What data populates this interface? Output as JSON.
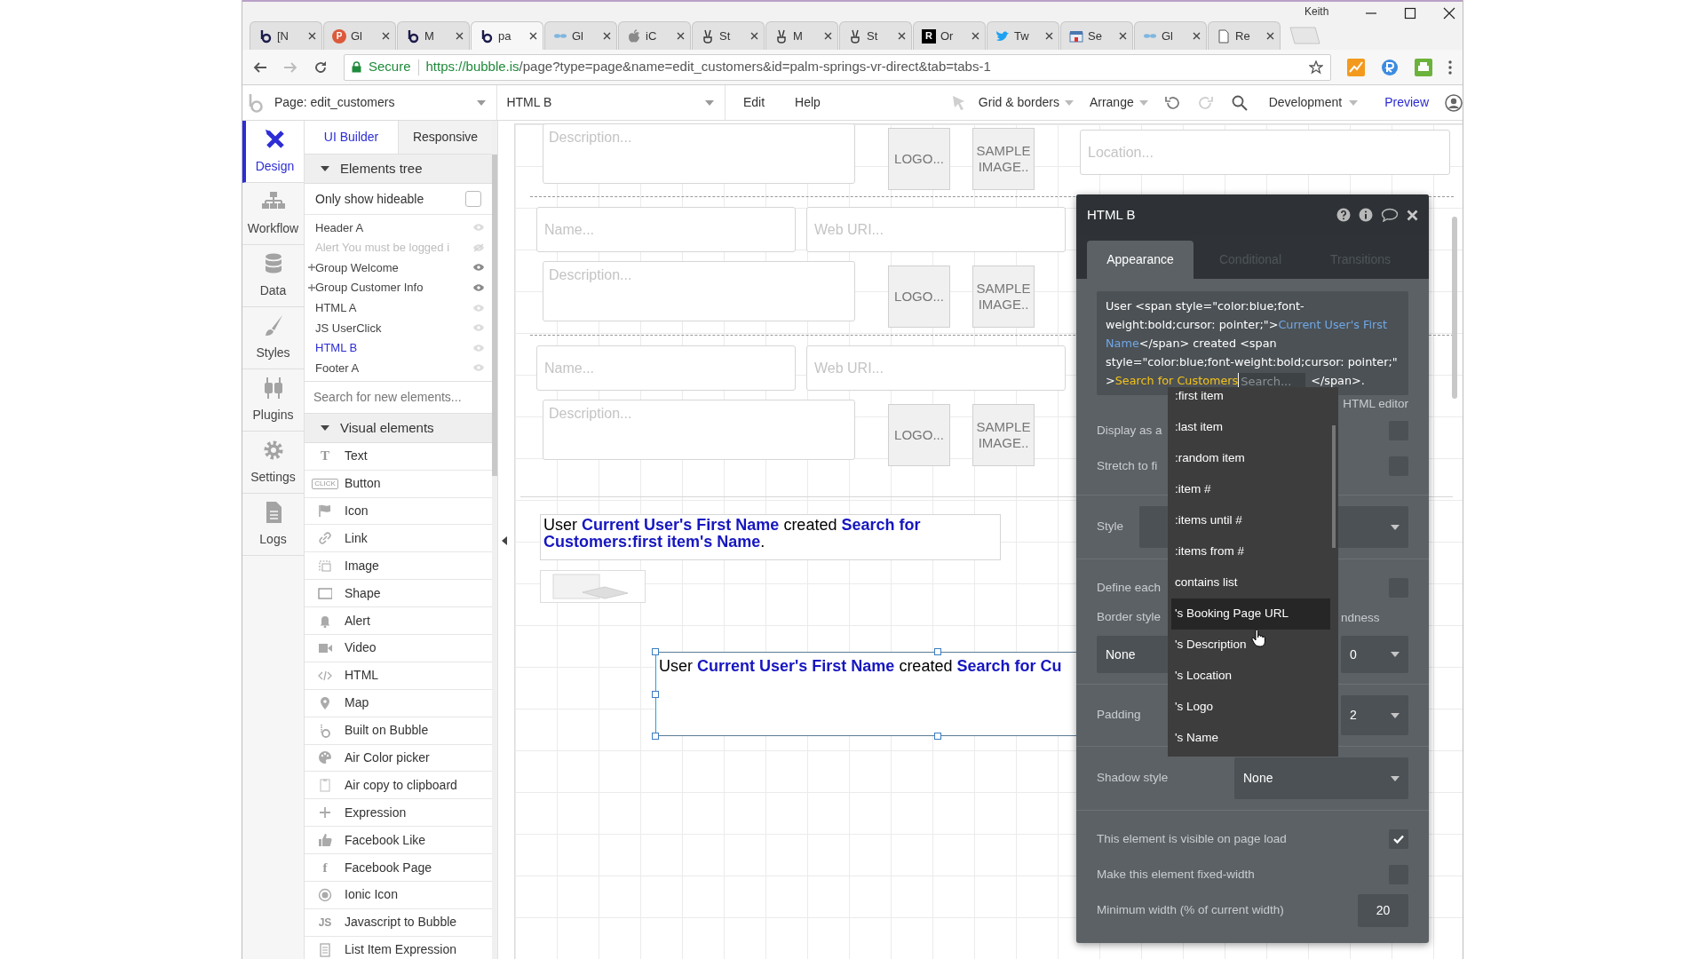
{
  "browser": {
    "tabs": [
      {
        "label": "[N",
        "kind": "bubble",
        "selected": false
      },
      {
        "label": "Gl",
        "kind": "circle-letter",
        "icon_text": "P",
        "selected": false
      },
      {
        "label": "M",
        "kind": "bubble",
        "selected": false
      },
      {
        "label": "pa",
        "kind": "bubble",
        "selected": true
      },
      {
        "label": "Gl",
        "kind": "glasses",
        "selected": false
      },
      {
        "label": "iC",
        "kind": "apple",
        "selected": false
      },
      {
        "label": "St",
        "kind": "hand",
        "selected": false
      },
      {
        "label": "M",
        "kind": "hand",
        "selected": false
      },
      {
        "label": "St",
        "kind": "hand",
        "selected": false
      },
      {
        "label": "Or",
        "kind": "square-letter",
        "icon_text": "R",
        "selected": false
      },
      {
        "label": "Tw",
        "kind": "bird",
        "selected": false
      },
      {
        "label": "Se",
        "kind": "store",
        "selected": false
      },
      {
        "label": "Gl",
        "kind": "glasses",
        "selected": false
      },
      {
        "label": "Re",
        "kind": "page",
        "selected": false
      }
    ],
    "user": "Keith",
    "secure_label": "Secure",
    "url_host": "https://bubble.is",
    "url_path": "/page?type=page&name=edit_customers&id=palm-springs-vr-direct&tab=tabs-1"
  },
  "toolbar": {
    "page_select": "Page: edit_customers",
    "element_select": "HTML B",
    "menus": [
      "Edit",
      "Help"
    ],
    "grid": "Grid & borders",
    "arrange": "Arrange",
    "mode": "Development",
    "preview": "Preview"
  },
  "nav": [
    {
      "label": "Design",
      "kind": "design",
      "selected": true
    },
    {
      "label": "Workflow",
      "kind": "workflow",
      "selected": false
    },
    {
      "label": "Data",
      "kind": "data",
      "selected": false
    },
    {
      "label": "Styles",
      "kind": "styles",
      "selected": false
    },
    {
      "label": "Plugins",
      "kind": "plugins",
      "selected": false
    },
    {
      "label": "Settings",
      "kind": "settings",
      "selected": false
    },
    {
      "label": "Logs",
      "kind": "logs",
      "selected": false
    }
  ],
  "builder_tabs": [
    {
      "label": "UI Builder",
      "selected": true
    },
    {
      "label": "Responsive",
      "selected": false
    }
  ],
  "elements_tree": {
    "title": "Elements tree",
    "hideable_label": "Only show hideable",
    "hideable_checked": false,
    "items": [
      {
        "label": "Header A",
        "expandable": false,
        "selected": false,
        "visible": true
      },
      {
        "label": "Alert You must be logged i",
        "expandable": false,
        "selected": false,
        "visible": false
      },
      {
        "label": "Group Welcome",
        "expandable": true,
        "selected": false,
        "visible": true
      },
      {
        "label": "Group Customer Info",
        "expandable": true,
        "selected": false,
        "visible": true
      },
      {
        "label": "HTML A",
        "expandable": false,
        "selected": false,
        "visible": true
      },
      {
        "label": "JS UserClick",
        "expandable": false,
        "selected": false,
        "visible": true
      },
      {
        "label": "HTML B",
        "expandable": false,
        "selected": true,
        "visible": true
      },
      {
        "label": "Footer A",
        "expandable": false,
        "selected": false,
        "visible": true
      }
    ],
    "search_placeholder": "Search for new elements..."
  },
  "visual_elements": {
    "title": "Visual elements",
    "items": [
      {
        "label": "Text",
        "kind": "letter",
        "icon_text": "T"
      },
      {
        "label": "Button",
        "kind": "badge",
        "icon_text": "CLICK"
      },
      {
        "label": "Icon",
        "kind": "flag"
      },
      {
        "label": "Link",
        "kind": "link"
      },
      {
        "label": "Image",
        "kind": "image"
      },
      {
        "label": "Shape",
        "kind": "shape"
      },
      {
        "label": "Alert",
        "kind": "bell"
      },
      {
        "label": "Video",
        "kind": "video"
      },
      {
        "label": "HTML",
        "kind": "code"
      },
      {
        "label": "Map",
        "kind": "pin"
      },
      {
        "label": "Built on Bubble",
        "kind": "bubble"
      },
      {
        "label": "Air Color picker",
        "kind": "palette"
      },
      {
        "label": "Air copy to clipboard",
        "kind": "clipboard"
      },
      {
        "label": "Expression",
        "kind": "plus"
      },
      {
        "label": "Facebook Like",
        "kind": "thumb"
      },
      {
        "label": "Facebook Page",
        "kind": "letter",
        "icon_text": "f"
      },
      {
        "label": "Ionic Icon",
        "kind": "ring"
      },
      {
        "label": "Javascript to Bubble",
        "kind": "letter",
        "icon_text": "JS"
      },
      {
        "label": "List Item Expression",
        "kind": "list"
      }
    ]
  },
  "canvas": {
    "location_placeholder": "Location...",
    "cells": [
      {
        "kind": "partial",
        "description_placeholder": "Description...",
        "logo": "LOGO...",
        "sample_image": "SAMPLE IMAGE.."
      },
      {
        "kind": "full",
        "name_placeholder": "Name...",
        "url_placeholder": "Web URI...",
        "description_placeholder": "Description...",
        "logo": "LOGO...",
        "sample_image": "SAMPLE IMAGE.."
      },
      {
        "kind": "full",
        "name_placeholder": "Name...",
        "url_placeholder": "Web URI...",
        "description_placeholder": "Description...",
        "logo": "LOGO...",
        "sample_image": "SAMPLE IMAGE.."
      }
    ],
    "text_element": "User **Current User's First Name** created **Search for Customers:first item's Name**.",
    "html_element": "User **Current User's First Name** created **Search for Cu**"
  },
  "property_editor": {
    "title": "HTML B",
    "tabs": [
      {
        "label": "Appearance",
        "selected": true
      },
      {
        "label": "Conditional",
        "selected": false
      },
      {
        "label": "Transitions",
        "selected": false
      }
    ],
    "code": [
      {
        "kind": "code",
        "text": "User <span style=\"color:blue;font-weight:bold;cursor: pointer;\">"
      },
      {
        "kind": "dynamic",
        "text": "Current User's First Name"
      },
      {
        "kind": "code",
        "text": "</span> created <span style=\"color:blue;font-weight:bold;cursor: pointer;\" >"
      },
      {
        "kind": "expression",
        "text": "Search for Customers"
      },
      {
        "kind": "search",
        "placeholder": "Search..."
      },
      {
        "kind": "code",
        "text": "</span>."
      }
    ],
    "editor_label": "HTML editor",
    "rows": [
      {
        "kind": "checkbox",
        "label": "Display as a",
        "checked": false
      },
      {
        "kind": "checkbox",
        "label": "Stretch to fi",
        "checked": false
      },
      {
        "kind": "divider"
      },
      {
        "kind": "select",
        "label": "Style"
      },
      {
        "kind": "divider"
      },
      {
        "kind": "checkbox",
        "label": "Define each",
        "checked": false
      },
      {
        "kind": "pair",
        "label": "Border style",
        "label_2": "ndness",
        "value": "None",
        "value_2": "0"
      },
      {
        "kind": "divider"
      },
      {
        "kind": "select_small",
        "label": "Padding",
        "value": "2"
      },
      {
        "kind": "divider"
      },
      {
        "kind": "select",
        "label": "Shadow style",
        "value": "None"
      },
      {
        "kind": "divider"
      },
      {
        "kind": "checkbox",
        "label": "This element is visible on page load",
        "checked": true
      },
      {
        "kind": "checkbox",
        "label": "Make this element fixed-width",
        "checked": false
      },
      {
        "kind": "number",
        "label": "Minimum width (% of current width)",
        "value": "20"
      }
    ],
    "suggestions": [
      {
        "label": ":first item",
        "highlighted": false
      },
      {
        "label": ":last item",
        "highlighted": false
      },
      {
        "label": ":random item",
        "highlighted": false
      },
      {
        "label": ":item #",
        "highlighted": false
      },
      {
        "label": ":items until #",
        "highlighted": false
      },
      {
        "label": ":items from #",
        "highlighted": false
      },
      {
        "label": "contains list",
        "highlighted": false
      },
      {
        "label": "'s Booking Page URL",
        "highlighted": true
      },
      {
        "label": "'s Description",
        "highlighted": false
      },
      {
        "label": "'s Location",
        "highlighted": false
      },
      {
        "label": "'s Logo",
        "highlighted": false
      },
      {
        "label": "'s Name",
        "highlighted": false
      }
    ]
  }
}
